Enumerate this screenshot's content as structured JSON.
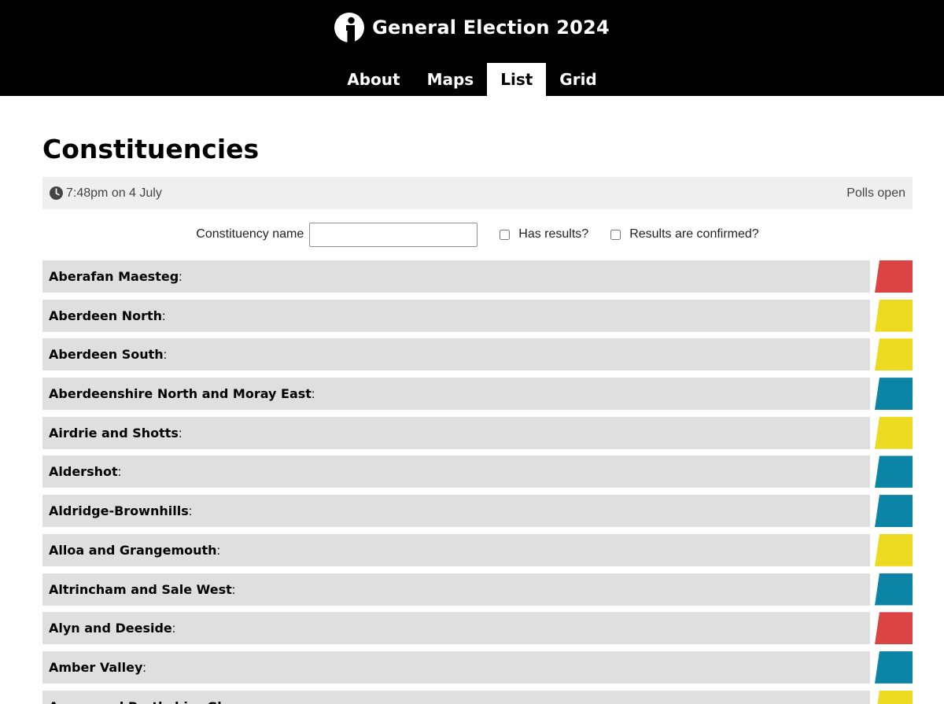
{
  "header": {
    "logo_icon": "info-i-logo-icon",
    "title": "General Election 2024"
  },
  "nav": {
    "tabs": [
      {
        "label": "About",
        "active": false
      },
      {
        "label": "Maps",
        "active": false
      },
      {
        "label": "List",
        "active": true
      },
      {
        "label": "Grid",
        "active": false
      }
    ]
  },
  "page": {
    "title": "Constituencies"
  },
  "status": {
    "clock_icon": "clock-icon",
    "time": "7:48pm on 4 July",
    "state": "Polls open"
  },
  "filters": {
    "name_label": "Constituency name",
    "name_value": "",
    "has_results_label": "Has results?",
    "has_results_checked": false,
    "confirmed_label": "Results are confirmed?",
    "confirmed_checked": false
  },
  "colors": {
    "red": "#dc4443",
    "yellow": "#ecdb21",
    "blue": "#0b84a5"
  },
  "constituencies": [
    {
      "name": "Aberafan Maesteg",
      "color": "#dc4443"
    },
    {
      "name": "Aberdeen North",
      "color": "#ecdb21"
    },
    {
      "name": "Aberdeen South",
      "color": "#ecdb21"
    },
    {
      "name": "Aberdeenshire North and Moray East",
      "color": "#0b84a5"
    },
    {
      "name": "Airdrie and Shotts",
      "color": "#ecdb21"
    },
    {
      "name": "Aldershot",
      "color": "#0b84a5"
    },
    {
      "name": "Aldridge-Brownhills",
      "color": "#0b84a5"
    },
    {
      "name": "Alloa and Grangemouth",
      "color": "#ecdb21"
    },
    {
      "name": "Altrincham and Sale West",
      "color": "#0b84a5"
    },
    {
      "name": "Alyn and Deeside",
      "color": "#dc4443"
    },
    {
      "name": "Amber Valley",
      "color": "#0b84a5"
    },
    {
      "name": "Angus and Perthshire Glens",
      "color": "#ecdb21"
    }
  ]
}
